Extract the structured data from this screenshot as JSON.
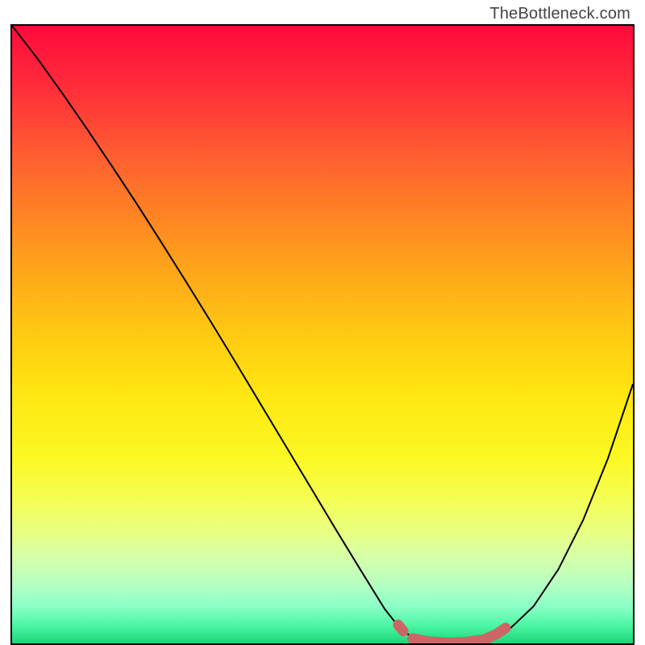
{
  "watermark": "TheBottleneck.com",
  "chart_data": {
    "type": "line",
    "title": "",
    "xlabel": "",
    "ylabel": "",
    "xlim": [
      0,
      100
    ],
    "ylim": [
      0,
      100
    ],
    "series": [
      {
        "name": "bottleneck-curve",
        "x": [
          0,
          4,
          8,
          12,
          16,
          20,
          24,
          28,
          32,
          36,
          40,
          44,
          48,
          52,
          56,
          60,
          62.5,
          65,
          67,
          70,
          73,
          76,
          80,
          84,
          88,
          92,
          96,
          100
        ],
        "y": [
          100,
          94.8,
          89.2,
          83.4,
          77.4,
          71.3,
          65,
          58.6,
          52.1,
          45.5,
          38.8,
          32.1,
          25.4,
          18.7,
          12.1,
          5.6,
          2.4,
          0.6,
          0.2,
          0.1,
          0.2,
          0.6,
          2.2,
          6.0,
          12.0,
          20.0,
          30.0,
          42.0
        ]
      }
    ],
    "highlight": {
      "name": "optimal-range",
      "color": "#cc6666",
      "segments": [
        {
          "x": [
            62.2,
            63.0
          ],
          "y": [
            3.0,
            2.0
          ]
        },
        {
          "x": [
            64.5,
            67,
            70,
            73,
            76,
            78,
            79.5
          ],
          "y": [
            0.8,
            0.3,
            0.1,
            0.2,
            0.6,
            1.5,
            2.5
          ]
        }
      ]
    },
    "background_gradient": {
      "top": "#ff0a3c",
      "mid1": "#ffca12",
      "mid2": "#fbf823",
      "bottom": "#1cd578"
    }
  }
}
